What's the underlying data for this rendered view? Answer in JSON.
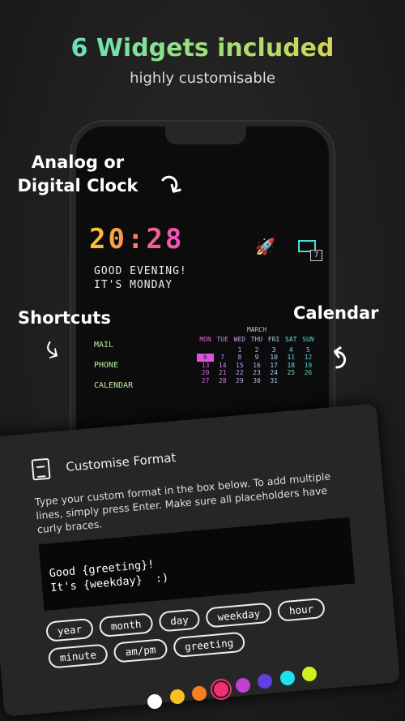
{
  "header": {
    "title": "6 Widgets included",
    "subtitle": "highly customisable"
  },
  "labels": {
    "clock": "Analog or\nDigital Clock",
    "shortcuts": "Shortcuts",
    "calendar": "Calendar"
  },
  "widget": {
    "time": "20:28",
    "greeting_line1": "GOOD EVENING!",
    "greeting_line2": "IT'S MONDAY",
    "mail_count": "7",
    "shortcuts": [
      "MAIL",
      "PHONE",
      "CALENDAR"
    ]
  },
  "calendar": {
    "month": "MARCH",
    "days": [
      "MON",
      "TUE",
      "WED",
      "THU",
      "FRI",
      "SAT",
      "SUN"
    ],
    "today": "6",
    "weeks": [
      [
        "",
        "",
        "1",
        "2",
        "3",
        "4",
        "5"
      ],
      [
        "6",
        "7",
        "8",
        "9",
        "10",
        "11",
        "12"
      ],
      [
        "13",
        "14",
        "15",
        "16",
        "17",
        "18",
        "19"
      ],
      [
        "20",
        "21",
        "22",
        "23",
        "24",
        "25",
        "26"
      ],
      [
        "27",
        "28",
        "29",
        "30",
        "31",
        "",
        ""
      ]
    ],
    "column_colors": [
      "#e060e0",
      "#d080e0",
      "#c0a0e8",
      "#b8b8e8",
      "#a8d0e8",
      "#70d8d8",
      "#50d8d0"
    ]
  },
  "dialog": {
    "title": "Customise Format",
    "description": "Type your custom format in the box below. To add multiple lines, simply press Enter. Make sure all placeholders have curly braces.",
    "format_value": "Good {greeting}!\nIt's {weekday}  :)",
    "chips": [
      "year",
      "month",
      "day",
      "weekday",
      "hour",
      "minute",
      "am/pm",
      "greeting"
    ]
  },
  "colors": {
    "options": [
      "#ffffff",
      "#f8c020",
      "#f88020",
      "#f03070",
      "#c040d0",
      "#6040e0",
      "#20e0f0",
      "#d0f020"
    ],
    "selected_index": 3
  }
}
